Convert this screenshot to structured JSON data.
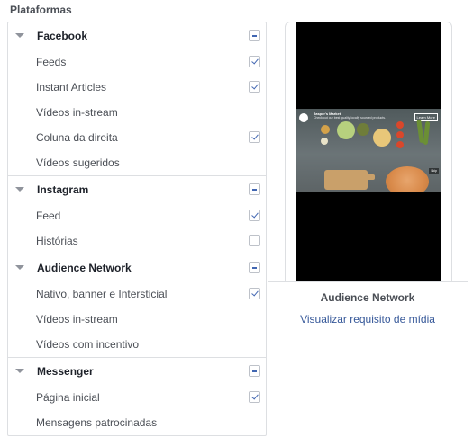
{
  "section_title": "Plataformas",
  "groups": [
    {
      "label": "Facebook",
      "state": "partial",
      "items": [
        {
          "label": "Feeds",
          "state": "checked"
        },
        {
          "label": "Instant Articles",
          "state": "checked"
        },
        {
          "label": "Vídeos in-stream",
          "state": "none"
        },
        {
          "label": "Coluna da direita",
          "state": "checked"
        },
        {
          "label": "Vídeos sugeridos",
          "state": "none"
        }
      ]
    },
    {
      "label": "Instagram",
      "state": "partial",
      "items": [
        {
          "label": "Feed",
          "state": "checked"
        },
        {
          "label": "Histórias",
          "state": "unchecked"
        }
      ]
    },
    {
      "label": "Audience Network",
      "state": "partial",
      "items": [
        {
          "label": "Nativo, banner e Intersticial",
          "state": "checked"
        },
        {
          "label": "Vídeos in-stream",
          "state": "none"
        },
        {
          "label": "Vídeos com incentivo",
          "state": "none"
        }
      ]
    },
    {
      "label": "Messenger",
      "state": "partial",
      "items": [
        {
          "label": "Página inicial",
          "state": "checked"
        },
        {
          "label": "Mensagens patrocinadas",
          "state": "none"
        }
      ]
    }
  ],
  "preview": {
    "ad_title": "Jasper's Market",
    "ad_text": "Check out our best quality locally sourced products.",
    "cta": "Learn More",
    "skip": "Skip",
    "caption": "Audience Network",
    "link": "Visualizar requisito de mídia"
  },
  "colors": {
    "accent": "#4267b2",
    "link": "#365899",
    "border": "#dddfe2"
  }
}
